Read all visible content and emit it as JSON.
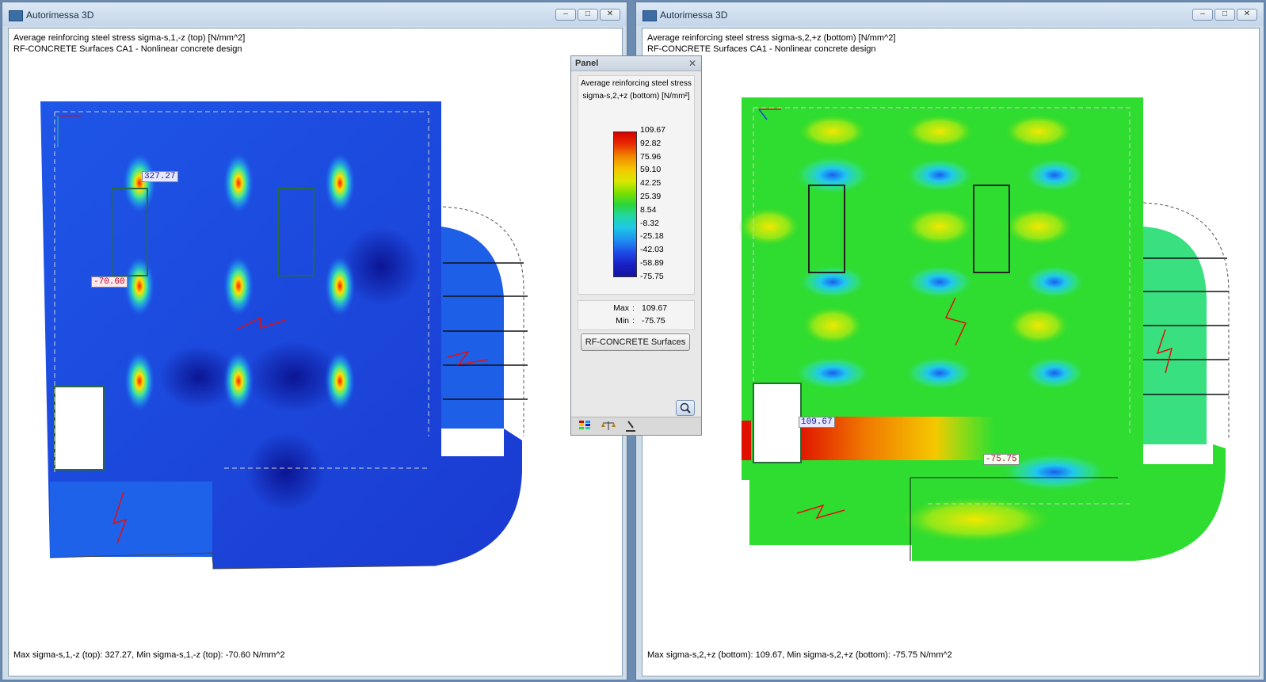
{
  "left_window": {
    "title": "Autorimessa 3D",
    "info_line1": "Average reinforcing steel stress sigma-s,1,-z (top) [N/mm^2]",
    "info_line2": "RF-CONCRETE Surfaces CA1 - Nonlinear concrete design",
    "max_label": "327.27",
    "min_label": "-70.60",
    "status": "Max sigma-s,1,-z (top): 327.27, Min sigma-s,1,-z (top): -70.60 N/mm^2"
  },
  "right_window": {
    "title": "Autorimessa 3D",
    "info_line1": "Average reinforcing steel stress sigma-s,2,+z (bottom) [N/mm^2]",
    "info_line2": "RF-CONCRETE Surfaces CA1 - Nonlinear concrete design",
    "max_label": "109.67",
    "min_label": "-75.75",
    "status": "Max sigma-s,2,+z (bottom): 109.67, Min sigma-s,2,+z (bottom): -75.75 N/mm^2"
  },
  "panel": {
    "title": "Panel",
    "label_line1": "Average reinforcing steel stress",
    "label_line2": "sigma-s,2,+z (bottom) [N/mm²]",
    "scale": [
      "109.67",
      "92.82",
      "75.96",
      "59.10",
      "42.25",
      "25.39",
      "8.54",
      "-8.32",
      "-25.18",
      "-42.03",
      "-58.89",
      "-75.75"
    ],
    "max_key": "Max",
    "max_value": "109.67",
    "min_key": "Min",
    "min_value": "-75.75",
    "button": "RF-CONCRETE Surfaces"
  },
  "icons": {
    "close": "close-icon",
    "minimize": "minimize-icon",
    "maximize": "maximize-icon",
    "zoom": "magnifier-icon"
  },
  "colors": {
    "max_color": "#d40000",
    "min_color": "#1015a0",
    "title_bg": "#cfdcea"
  }
}
